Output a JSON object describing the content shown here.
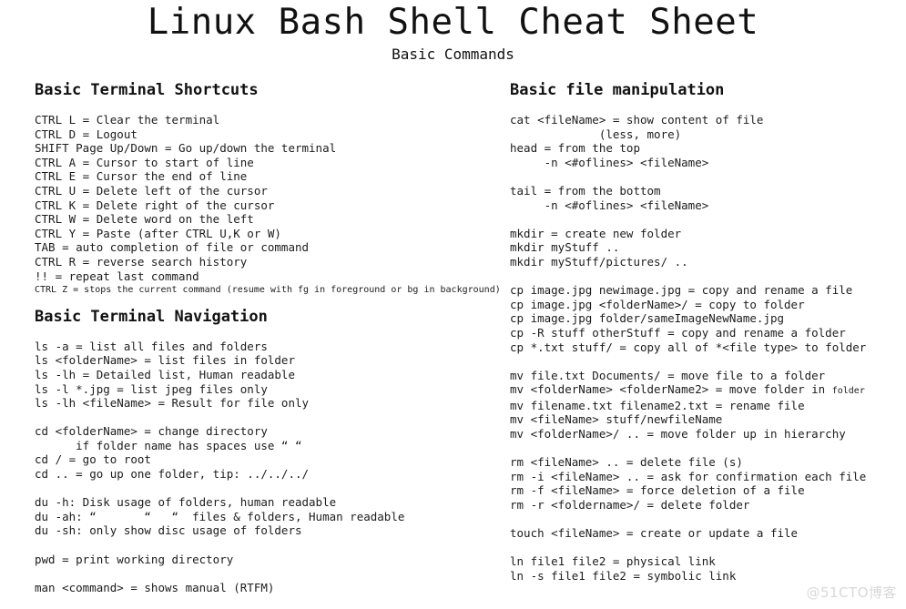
{
  "header": {
    "title": "Linux Bash Shell Cheat Sheet",
    "subtitle": "Basic Commands"
  },
  "watermark": "@51CTO博客",
  "left_column": {
    "sections": [
      {
        "heading": "Basic Terminal Shortcuts",
        "lines": [
          {
            "text": "CTRL L = Clear the terminal",
            "size": "normal"
          },
          {
            "text": "CTRL D = Logout",
            "size": "normal"
          },
          {
            "text": "SHIFT Page Up/Down = Go up/down the terminal",
            "size": "normal"
          },
          {
            "text": "CTRL A = Cursor to start of line",
            "size": "normal"
          },
          {
            "text": "CTRL E = Cursor the end of line",
            "size": "normal"
          },
          {
            "text": "CTRL U = Delete left of the cursor",
            "size": "normal"
          },
          {
            "text": "CTRL K = Delete right of the cursor",
            "size": "normal"
          },
          {
            "text": "CTRL W = Delete word on the left",
            "size": "normal"
          },
          {
            "text": "CTRL Y = Paste (after CTRL U,K or W)",
            "size": "normal"
          },
          {
            "text": "TAB = auto completion of file or command",
            "size": "normal"
          },
          {
            "text": "CTRL R = reverse search history",
            "size": "normal"
          },
          {
            "text": "!! = repeat last command",
            "size": "normal"
          },
          {
            "text": "CTRL Z = stops the current command (resume with fg in foreground or bg in background)",
            "size": "small"
          }
        ]
      },
      {
        "heading": "Basic Terminal Navigation",
        "lines": [
          {
            "text": "ls -a = list all files and folders",
            "size": "normal"
          },
          {
            "text": "ls <folderName> = list files in folder",
            "size": "normal"
          },
          {
            "text": "ls -lh = Detailed list, Human readable",
            "size": "normal"
          },
          {
            "text": "ls -l *.jpg = list jpeg files only",
            "size": "normal"
          },
          {
            "text": "ls -lh <fileName> = Result for file only",
            "size": "normal"
          },
          {
            "text": "",
            "size": "blank"
          },
          {
            "text": "cd <folderName> = change directory",
            "size": "normal"
          },
          {
            "text": "      if folder name has spaces use “ “",
            "size": "normal"
          },
          {
            "text": "cd / = go to root",
            "size": "normal"
          },
          {
            "text": "cd .. = go up one folder, tip: ../../../",
            "size": "normal"
          },
          {
            "text": "",
            "size": "blank"
          },
          {
            "text": "du -h: Disk usage of folders, human readable",
            "size": "normal"
          },
          {
            "text": "du -ah: “       “   “  files & folders, Human readable",
            "size": "normal"
          },
          {
            "text": "du -sh: only show disc usage of folders",
            "size": "normal"
          },
          {
            "text": "",
            "size": "blank"
          },
          {
            "text": "pwd = print working directory",
            "size": "normal"
          },
          {
            "text": "",
            "size": "blank"
          },
          {
            "text": "man <command> = shows manual (RTFM)",
            "size": "normal"
          }
        ]
      }
    ]
  },
  "right_column": {
    "sections": [
      {
        "heading": "Basic file manipulation",
        "lines": [
          {
            "text": "cat <fileName> = show content of file",
            "size": "normal"
          },
          {
            "text": "             (less, more)",
            "size": "normal"
          },
          {
            "text": "head = from the top",
            "size": "normal"
          },
          {
            "text": "     -n <#oflines> <fileName>",
            "size": "normal"
          },
          {
            "text": "",
            "size": "blank"
          },
          {
            "text": "tail = from the bottom",
            "size": "normal"
          },
          {
            "text": "     -n <#oflines> <fileName>",
            "size": "normal"
          },
          {
            "text": "",
            "size": "blank"
          },
          {
            "text": "mkdir = create new folder",
            "size": "normal"
          },
          {
            "text": "mkdir myStuff ..",
            "size": "normal"
          },
          {
            "text": "mkdir myStuff/pictures/ ..",
            "size": "normal"
          },
          {
            "text": "",
            "size": "blank"
          },
          {
            "text": "cp image.jpg newimage.jpg = copy and rename a file",
            "size": "normal"
          },
          {
            "text": "cp image.jpg <folderName>/ = copy to folder",
            "size": "normal"
          },
          {
            "text": "cp image.jpg folder/sameImageNewName.jpg",
            "size": "normal"
          },
          {
            "text": "cp -R stuff otherStuff = copy and rename a folder",
            "size": "normal"
          },
          {
            "text": "cp *.txt stuff/ = copy all of *<file type> to folder",
            "size": "normal"
          },
          {
            "text": "",
            "size": "blank"
          },
          {
            "text": "mv file.txt Documents/ = move file to a folder",
            "size": "normal"
          },
          {
            "text": "mv <folderName> <folderName2> = move folder in ",
            "size": "normal",
            "suffix_small": "folder"
          },
          {
            "text": "mv filename.txt filename2.txt = rename file",
            "size": "normal"
          },
          {
            "text": "mv <fileName> stuff/newfileName",
            "size": "normal"
          },
          {
            "text": "mv <folderName>/ .. = move folder up in hierarchy",
            "size": "normal"
          },
          {
            "text": "",
            "size": "blank"
          },
          {
            "text": "rm <fileName> .. = delete file (s)",
            "size": "normal"
          },
          {
            "text": "rm -i <fileName> .. = ask for confirmation each file",
            "size": "normal"
          },
          {
            "text": "rm -f <fileName> = force deletion of a file",
            "size": "normal"
          },
          {
            "text": "rm -r <foldername>/ = delete folder",
            "size": "normal"
          },
          {
            "text": "",
            "size": "blank"
          },
          {
            "text": "touch <fileName> = create or update a file",
            "size": "normal"
          },
          {
            "text": "",
            "size": "blank"
          },
          {
            "text": "ln file1 file2 = physical link",
            "size": "normal"
          },
          {
            "text": "ln -s file1 file2 = symbolic link",
            "size": "normal"
          }
        ]
      }
    ]
  }
}
